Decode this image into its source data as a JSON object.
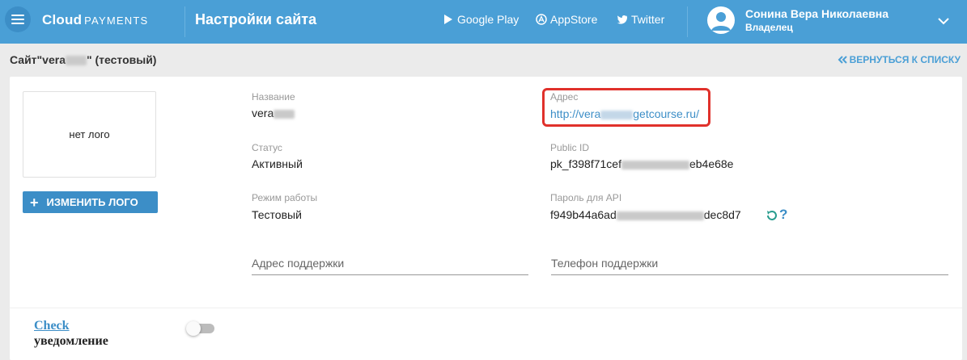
{
  "header": {
    "brand_main": "Cloud",
    "brand_sub": "PAYMENTS",
    "page_title": "Настройки сайта",
    "links": [
      "Google Play",
      "AppStore",
      "Twitter"
    ],
    "user_name": "Сонина Вера Николаевна",
    "user_role": "Владелец",
    "bg_color": "#4a9fd6"
  },
  "titlebar": {
    "site_prefix": "Сайт\"vera",
    "site_suffix": "\" (тестовый)",
    "back_label": "ВЕРНУТЬСЯ К СПИСКУ"
  },
  "logo": {
    "placeholder": "нет лого",
    "change_button": "ИЗМЕНИТЬ ЛОГО"
  },
  "fields": {
    "name_label": "Название",
    "name_value": "vera",
    "address_label": "Адрес",
    "address_value_prefix": "http://vera",
    "address_value_suffix": "getcourse.ru/",
    "status_label": "Статус",
    "status_value": "Активный",
    "public_id_label": "Public ID",
    "public_id_prefix": "pk_f398f71cef",
    "public_id_suffix": "eb4e68e",
    "mode_label": "Режим работы",
    "mode_value": "Тестовый",
    "api_label": "Пароль для API",
    "api_prefix": "f949b44a6ad",
    "api_suffix": "dec8d7"
  },
  "inputs": {
    "support_address_placeholder": "Адрес поддержки",
    "support_phone_placeholder": "Телефон поддержки"
  },
  "check": {
    "link": "Check",
    "sub": "уведомление",
    "enabled": false
  }
}
